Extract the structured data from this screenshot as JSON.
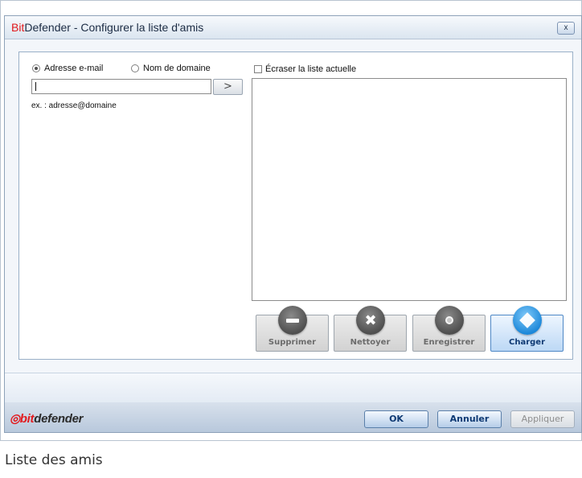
{
  "window": {
    "title_brand": "Bit",
    "title_rest": "Defender - Configurer la liste d'amis",
    "close_label": "x"
  },
  "left_panel": {
    "radio_email_label": "Adresse e-mail",
    "radio_email_checked": true,
    "radio_domain_label": "Nom de domaine",
    "radio_domain_checked": false,
    "input_value": "",
    "add_button_label": ">",
    "hint": "ex. : adresse@domaine"
  },
  "right_panel": {
    "overwrite_label": "Écraser la liste actuelle",
    "overwrite_checked": false,
    "list_items": []
  },
  "actions": [
    {
      "label": "Supprimer",
      "icon": "minus-icon",
      "active": false
    },
    {
      "label": "Nettoyer",
      "icon": "x-icon",
      "active": false
    },
    {
      "label": "Enregistrer",
      "icon": "disc-icon",
      "active": false
    },
    {
      "label": "Charger",
      "icon": "diamond-icon",
      "active": true
    }
  ],
  "footer": {
    "logo_prefix": "bit",
    "logo_suffix": "defender",
    "ok_label": "OK",
    "cancel_label": "Annuler",
    "apply_label": "Appliquer"
  },
  "caption": "Liste des amis",
  "colors": {
    "brand_red": "#e1181b",
    "accent_blue": "#1b87d9"
  }
}
